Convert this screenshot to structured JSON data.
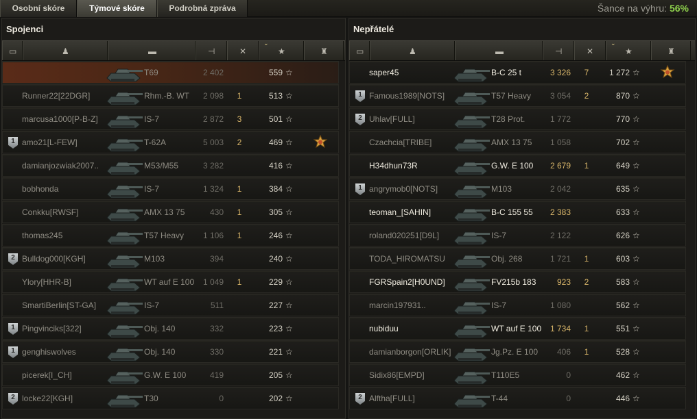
{
  "tabs": [
    {
      "label": "Osobní skóre",
      "active": false
    },
    {
      "label": "Týmové skóre",
      "active": true
    },
    {
      "label": "Podrobná zpráva",
      "active": false
    }
  ],
  "chance": {
    "label": "Šance na výhru:",
    "value": "56%"
  },
  "allies": {
    "title": "Spojenci",
    "rows": [
      {
        "name": "",
        "tank": "T69",
        "damage": "2 402",
        "kills": "",
        "xp": "559",
        "badge": "",
        "medal": false,
        "mine": true,
        "alive": false
      },
      {
        "name": "Runner22[22DGR]",
        "tank": "Rhm.-B. WT",
        "damage": "2 098",
        "kills": "1",
        "xp": "513",
        "badge": "",
        "medal": false,
        "mine": false,
        "alive": false
      },
      {
        "name": "marcusa1000[P-B-Z]",
        "tank": "IS-7",
        "damage": "2 872",
        "kills": "3",
        "xp": "501",
        "badge": "",
        "medal": false,
        "mine": false,
        "alive": false
      },
      {
        "name": "amo21[L-FEW]",
        "tank": "T-62A",
        "damage": "5 003",
        "kills": "2",
        "xp": "469",
        "badge": "1",
        "medal": true,
        "mine": false,
        "alive": false
      },
      {
        "name": "damianjozwiak2007..",
        "tank": "M53/M55",
        "damage": "3 282",
        "kills": "",
        "xp": "416",
        "badge": "",
        "medal": false,
        "mine": false,
        "alive": false
      },
      {
        "name": "bobhonda",
        "tank": "IS-7",
        "damage": "1 324",
        "kills": "1",
        "xp": "384",
        "badge": "",
        "medal": false,
        "mine": false,
        "alive": false
      },
      {
        "name": "Conkku[RWSF]",
        "tank": "AMX 13 75",
        "damage": "430",
        "kills": "1",
        "xp": "305",
        "badge": "",
        "medal": false,
        "mine": false,
        "alive": false
      },
      {
        "name": "thomas245",
        "tank": "T57 Heavy",
        "damage": "1 106",
        "kills": "1",
        "xp": "246",
        "badge": "",
        "medal": false,
        "mine": false,
        "alive": false
      },
      {
        "name": "Bulldog000[KGH]",
        "tank": "M103",
        "damage": "394",
        "kills": "",
        "xp": "240",
        "badge": "2",
        "medal": false,
        "mine": false,
        "alive": false
      },
      {
        "name": "Ylory[HHR-B]",
        "tank": "WT auf E 100",
        "damage": "1 049",
        "kills": "1",
        "xp": "229",
        "badge": "",
        "medal": false,
        "mine": false,
        "alive": false
      },
      {
        "name": "SmartiBerlin[ST-GA]",
        "tank": "IS-7",
        "damage": "511",
        "kills": "",
        "xp": "227",
        "badge": "",
        "medal": false,
        "mine": false,
        "alive": false
      },
      {
        "name": "Pingvinciks[322]",
        "tank": "Obj. 140",
        "damage": "332",
        "kills": "",
        "xp": "223",
        "badge": "1",
        "medal": false,
        "mine": false,
        "alive": false
      },
      {
        "name": "genghiswolves",
        "tank": "Obj. 140",
        "damage": "330",
        "kills": "",
        "xp": "221",
        "badge": "1",
        "medal": false,
        "mine": false,
        "alive": false
      },
      {
        "name": "picerek[I_CH]",
        "tank": "G.W. E 100",
        "damage": "419",
        "kills": "",
        "xp": "205",
        "badge": "",
        "medal": false,
        "mine": false,
        "alive": false
      },
      {
        "name": "locke22[KGH]",
        "tank": "T30",
        "damage": "0",
        "kills": "",
        "xp": "202",
        "badge": "2",
        "medal": false,
        "mine": false,
        "alive": false
      }
    ]
  },
  "enemies": {
    "title": "Nepřátelé",
    "rows": [
      {
        "name": "saper45",
        "tank": "B-C 25 t",
        "damage": "3 326",
        "kills": "7",
        "xp": "1 272",
        "badge": "",
        "medal": true,
        "mine": false,
        "alive": true
      },
      {
        "name": "Famous1989[NOTS]",
        "tank": "T57 Heavy",
        "damage": "3 054",
        "kills": "2",
        "xp": "870",
        "badge": "1",
        "medal": false,
        "mine": false,
        "alive": false
      },
      {
        "name": "Uhlav[FULL]",
        "tank": "T28 Prot.",
        "damage": "1 772",
        "kills": "",
        "xp": "770",
        "badge": "2",
        "medal": false,
        "mine": false,
        "alive": false
      },
      {
        "name": "Czachcia[TRIBE]",
        "tank": "AMX 13 75",
        "damage": "1 058",
        "kills": "",
        "xp": "702",
        "badge": "",
        "medal": false,
        "mine": false,
        "alive": false
      },
      {
        "name": "H34dhun73R",
        "tank": "G.W. E 100",
        "damage": "2 679",
        "kills": "1",
        "xp": "649",
        "badge": "",
        "medal": false,
        "mine": false,
        "alive": true
      },
      {
        "name": "angrymob0[NOTS]",
        "tank": "M103",
        "damage": "2 042",
        "kills": "",
        "xp": "635",
        "badge": "1",
        "medal": false,
        "mine": false,
        "alive": false
      },
      {
        "name": "teoman_[SAHIN]",
        "tank": "B-C 155 55",
        "damage": "2 383",
        "kills": "",
        "xp": "633",
        "badge": "",
        "medal": false,
        "mine": false,
        "alive": true
      },
      {
        "name": "roland020251[D9L]",
        "tank": "IS-7",
        "damage": "2 122",
        "kills": "",
        "xp": "626",
        "badge": "",
        "medal": false,
        "mine": false,
        "alive": false
      },
      {
        "name": "TODA_HIROMATSU",
        "tank": "Obj. 268",
        "damage": "1 721",
        "kills": "1",
        "xp": "603",
        "badge": "",
        "medal": false,
        "mine": false,
        "alive": false
      },
      {
        "name": "FGRSpain2[H0UND]",
        "tank": "FV215b 183",
        "damage": "923",
        "kills": "2",
        "xp": "583",
        "badge": "",
        "medal": false,
        "mine": false,
        "alive": true
      },
      {
        "name": "marcin197931..",
        "tank": "IS-7",
        "damage": "1 080",
        "kills": "",
        "xp": "562",
        "badge": "",
        "medal": false,
        "mine": false,
        "alive": false
      },
      {
        "name": "nubiduu",
        "tank": "WT auf E 100",
        "damage": "1 734",
        "kills": "1",
        "xp": "551",
        "badge": "",
        "medal": false,
        "mine": false,
        "alive": true
      },
      {
        "name": "damianborgon[ORLIK]",
        "tank": "Jg.Pz. E 100",
        "damage": "406",
        "kills": "1",
        "xp": "528",
        "badge": "",
        "medal": false,
        "mine": false,
        "alive": false
      },
      {
        "name": "Sidix86[EMPD]",
        "tank": "T110E5",
        "damage": "0",
        "kills": "",
        "xp": "462",
        "badge": "",
        "medal": false,
        "mine": false,
        "alive": false
      },
      {
        "name": "Alftha[FULL]",
        "tank": "T-44",
        "damage": "0",
        "kills": "",
        "xp": "446",
        "badge": "2",
        "medal": false,
        "mine": false,
        "alive": false
      }
    ]
  },
  "columns": [
    {
      "icon": "badge-column-icon"
    },
    {
      "icon": "player-column-icon"
    },
    {
      "icon": "tank-column-icon"
    },
    {
      "icon": "damage-column-icon"
    },
    {
      "icon": "kills-column-icon"
    },
    {
      "icon": "xp-column-icon"
    },
    {
      "icon": "medal-column-icon"
    }
  ],
  "colors": {
    "accent": "#8fd24d",
    "damage": "#d9b66a",
    "mine_row": "#5a2b18"
  }
}
